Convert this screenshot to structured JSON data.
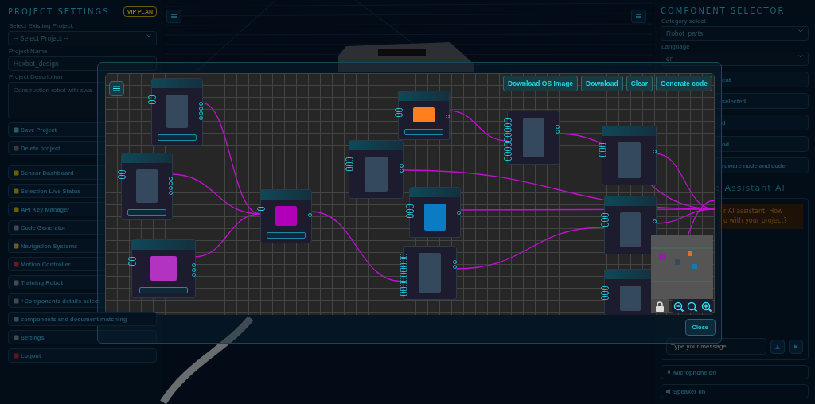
{
  "project_settings": {
    "title": "PROJECT SETTINGS",
    "badge": "VIP PLAN",
    "select_label": "Select Existing Project:",
    "select_value": "-- Select Project --",
    "name_label": "Project Name",
    "name_value": "Hexbot_design",
    "description_label": "Project Description",
    "description_value": "Construction robot  with swa"
  },
  "actions": [
    {
      "label": "Save Project"
    },
    {
      "label": "Delete project"
    }
  ],
  "menu": [
    {
      "label": "Sensor Dashboard"
    },
    {
      "label": "Selection Live Status"
    },
    {
      "label": "API Key Manager"
    },
    {
      "label": "Code Generator"
    },
    {
      "label": "Navigation Systems"
    },
    {
      "label": "Motion Controller"
    },
    {
      "label": "Training Robot"
    },
    {
      "label": "+Components details select"
    },
    {
      "label": "components and document matching"
    },
    {
      "label": "Settings"
    },
    {
      "label": "Logout"
    }
  ],
  "component_selector": {
    "title": "COMPONENT SELECTOR",
    "category_label": "Category select",
    "category_value": "Robot_parts",
    "language_label": "Language",
    "language_value": "en",
    "buttons": [
      "ent",
      "selected",
      "d",
      "od",
      "rdware node and code"
    ],
    "assistant_title": "g Assistant AI",
    "assistant_message": [
      "r AI assistant. How",
      "u with your project?"
    ],
    "message_placeholder": "Type your message...",
    "toggles": [
      "Microphone on",
      "Speaker on"
    ]
  },
  "graph_modal": {
    "toolbar": [
      "Download OS Image",
      "Download",
      "Clear",
      "Generate code"
    ],
    "close": "Close",
    "nodes": [
      {
        "kind": "titled",
        "color": "#34495e",
        "footer": true
      },
      {
        "kind": "titled",
        "color": "#34495e",
        "footer": true
      },
      {
        "kind": "titled",
        "color": "#b233c0",
        "footer": true
      },
      {
        "kind": "titled",
        "color": "#b000b8",
        "footer": true
      },
      {
        "kind": "titled",
        "color": "#34495e",
        "footer": false
      },
      {
        "kind": "titled",
        "color": "#ff7f1e",
        "footer": true
      },
      {
        "kind": "titled",
        "color": "#0a7cc4",
        "footer": false
      },
      {
        "kind": "plain",
        "color": "#34495e",
        "footer": false
      },
      {
        "kind": "titled",
        "color": "#34495e",
        "footer": false
      },
      {
        "kind": "titled",
        "color": "#34495e",
        "footer": false
      },
      {
        "kind": "plain",
        "color": "#34495e",
        "footer": false
      },
      {
        "kind": "titled",
        "color": "#34495e",
        "footer": false
      }
    ]
  }
}
